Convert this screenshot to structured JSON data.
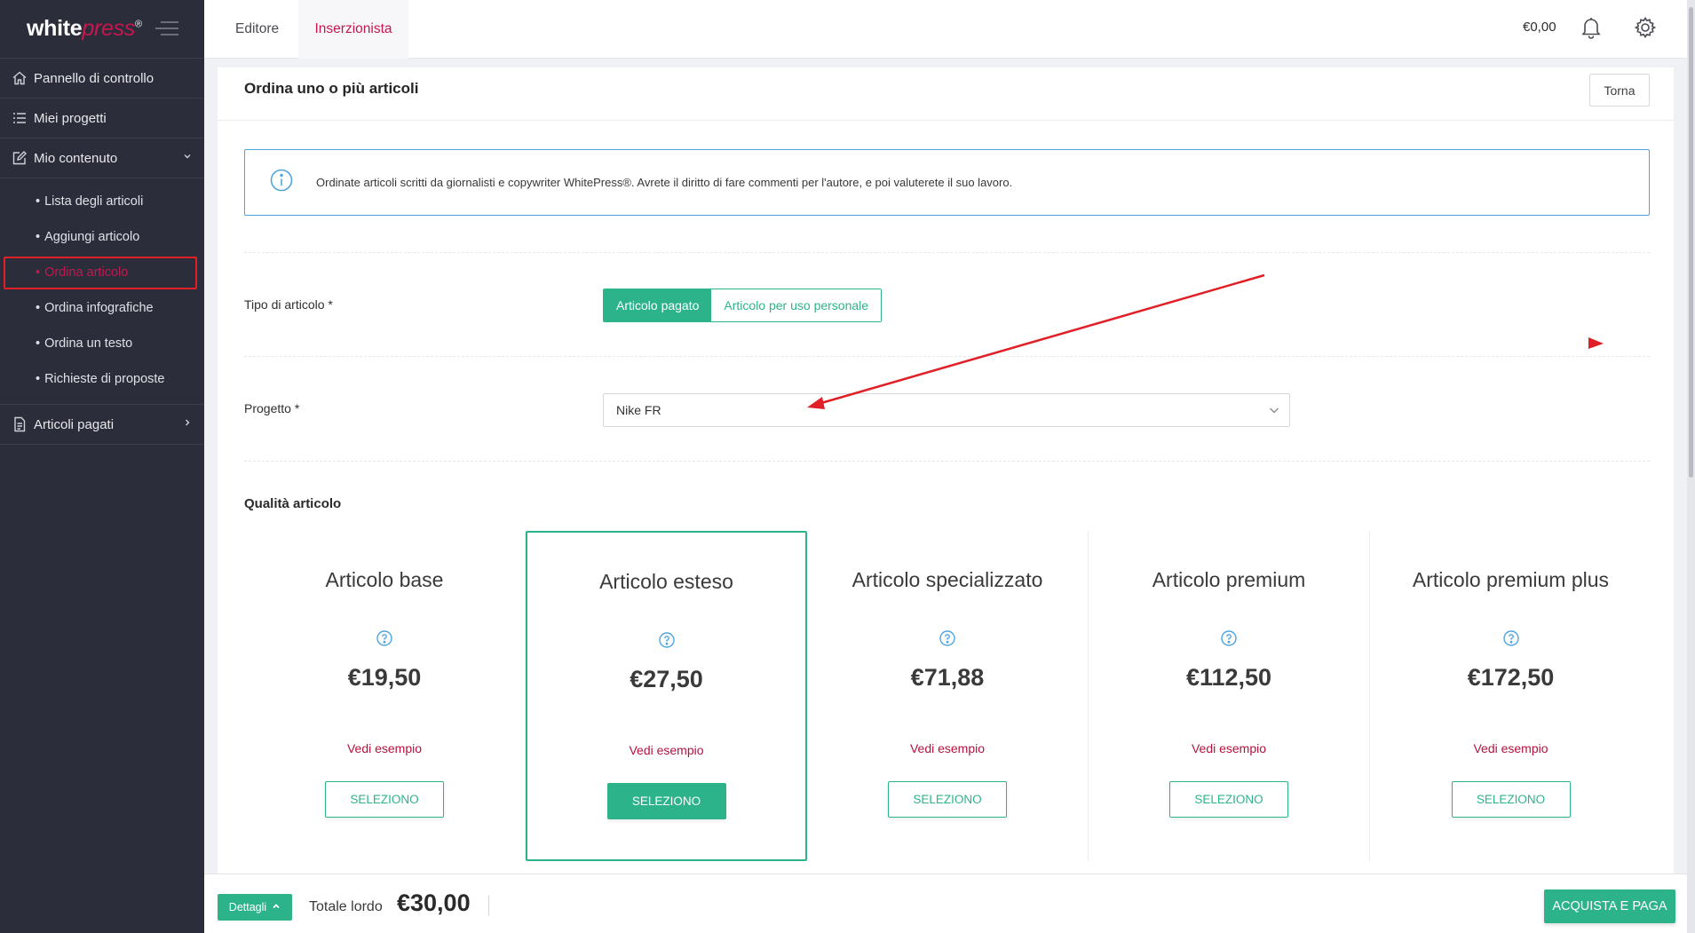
{
  "sidebar": {
    "logo_white": "white",
    "logo_press": "press",
    "logo_reg": "®",
    "items": [
      {
        "label": "Pannello di controllo",
        "icon": "home-icon"
      },
      {
        "label": "Miei progetti",
        "icon": "list-icon"
      },
      {
        "label": "Mio contenuto",
        "icon": "edit-icon"
      },
      {
        "label": "Articoli pagati",
        "icon": "document-icon"
      }
    ],
    "subitems": [
      {
        "label": "Lista degli articoli"
      },
      {
        "label": "Aggiungi articolo"
      },
      {
        "label": "Ordina articolo",
        "active": true
      },
      {
        "label": "Ordina infografiche"
      },
      {
        "label": "Ordina un testo"
      },
      {
        "label": "Richieste di proposte"
      }
    ]
  },
  "topbar": {
    "tabs": [
      "Editore",
      "Inserzionista"
    ],
    "active_tab": "Inserzionista",
    "balance": "€0,00"
  },
  "page": {
    "title": "Ordina uno o più articoli",
    "back_button": "Torna",
    "info_text": "Ordinate articoli scritti da giornalisti e copywriter WhitePress®. Avrete il diritto di fare commenti per l'autore, e poi valuterete il suo lavoro."
  },
  "form": {
    "type_label": "Tipo di articolo *",
    "type_options": [
      "Articolo pagato",
      "Articolo per uso personale"
    ],
    "type_selected": "Articolo pagato",
    "project_label": "Progetto *",
    "project_value": "Nike FR"
  },
  "quality": {
    "title": "Qualità articolo",
    "plans": [
      {
        "name": "Articolo base",
        "price": "€19,50",
        "example": "Vedi esempio",
        "button": "SELEZIONO"
      },
      {
        "name": "Articolo esteso",
        "price": "€27,50",
        "example": "Vedi esempio",
        "button": "SELEZIONO",
        "selected": true
      },
      {
        "name": "Articolo specializzato",
        "price": "€71,88",
        "example": "Vedi esempio",
        "button": "SELEZIONO"
      },
      {
        "name": "Articolo premium",
        "price": "€112,50",
        "example": "Vedi esempio",
        "button": "SELEZIONO"
      },
      {
        "name": "Articolo premium plus",
        "price": "€172,50",
        "example": "Vedi esempio",
        "button": "SELEZIONO"
      }
    ]
  },
  "footer": {
    "details_button": "Dettagli",
    "total_label": "Totale lordo",
    "total_value": "€30,00",
    "buy_button": "ACQUISTA E PAGA"
  },
  "colors": {
    "accent": "#2db38a",
    "brand": "#c6174e",
    "sidebar_bg": "#2b2d3a",
    "info_border": "#4fa5e0",
    "annotation_red": "#e01f26"
  }
}
